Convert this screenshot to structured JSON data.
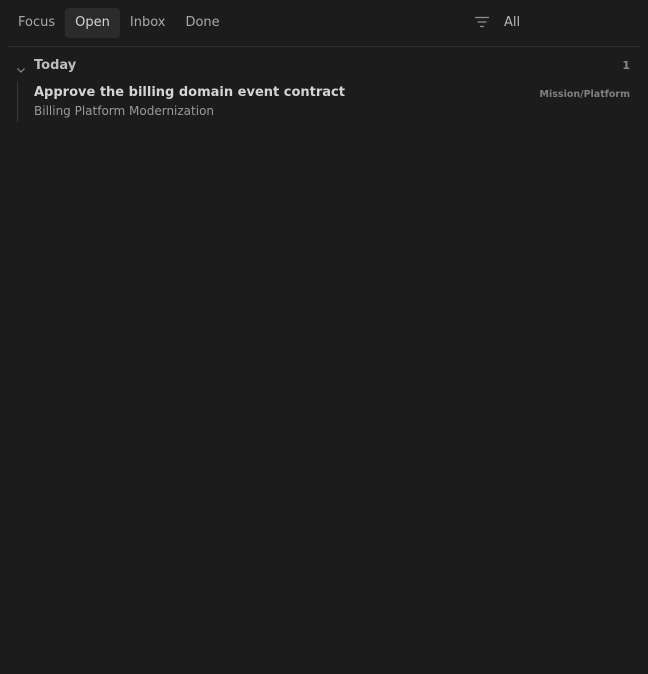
{
  "tabs": [
    {
      "label": "Focus",
      "active": false
    },
    {
      "label": "Open",
      "active": true
    },
    {
      "label": "Inbox",
      "active": false
    },
    {
      "label": "Done",
      "active": false
    }
  ],
  "filter": {
    "icon": "filter-icon",
    "label": "All"
  },
  "groups": [
    {
      "title": "Today",
      "count": "1",
      "icon": "chevron-down-icon",
      "items": [
        {
          "title": "Approve the billing domain event contract",
          "subtitle": "Billing Platform Modernization",
          "tag": "Mission/Platform"
        }
      ]
    }
  ],
  "colors": {
    "background": "#1c1c1c",
    "active_tab": "#2b2b2b",
    "divider": "#2e2e2e"
  }
}
